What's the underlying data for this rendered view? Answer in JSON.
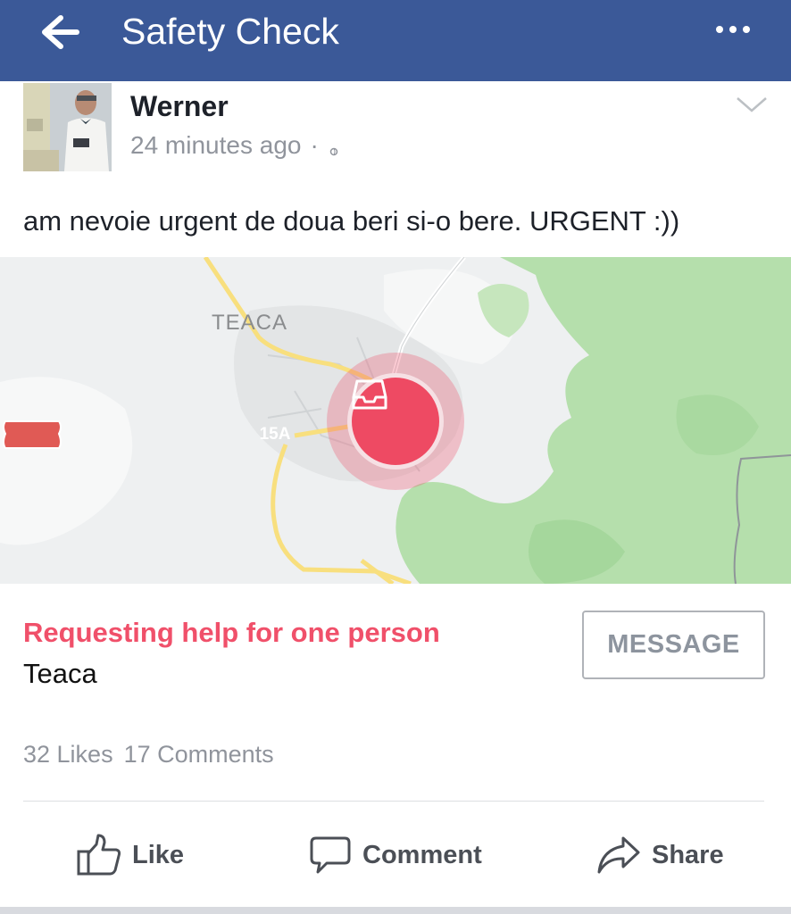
{
  "header": {
    "title": "Safety Check",
    "back_icon": "back-arrow-icon",
    "menu_icon": "more-options-icon",
    "background_color": "#3b5998"
  },
  "post": {
    "author": "Werner",
    "time": "24 minutes ago",
    "separator": "·",
    "text": "am nevoie urgent de doua beri si-o bere.  URGENT :))",
    "map": {
      "place_label": "TEACA",
      "route_label": "15A"
    },
    "safety": {
      "status": "Requesting help for one person",
      "location": "Teaca",
      "message_button": "MESSAGE",
      "status_color": "#f0506a"
    },
    "stats": {
      "likes": "32 Likes",
      "comments": "17 Comments"
    },
    "actions": {
      "like": "Like",
      "comment": "Comment",
      "share": "Share"
    }
  }
}
